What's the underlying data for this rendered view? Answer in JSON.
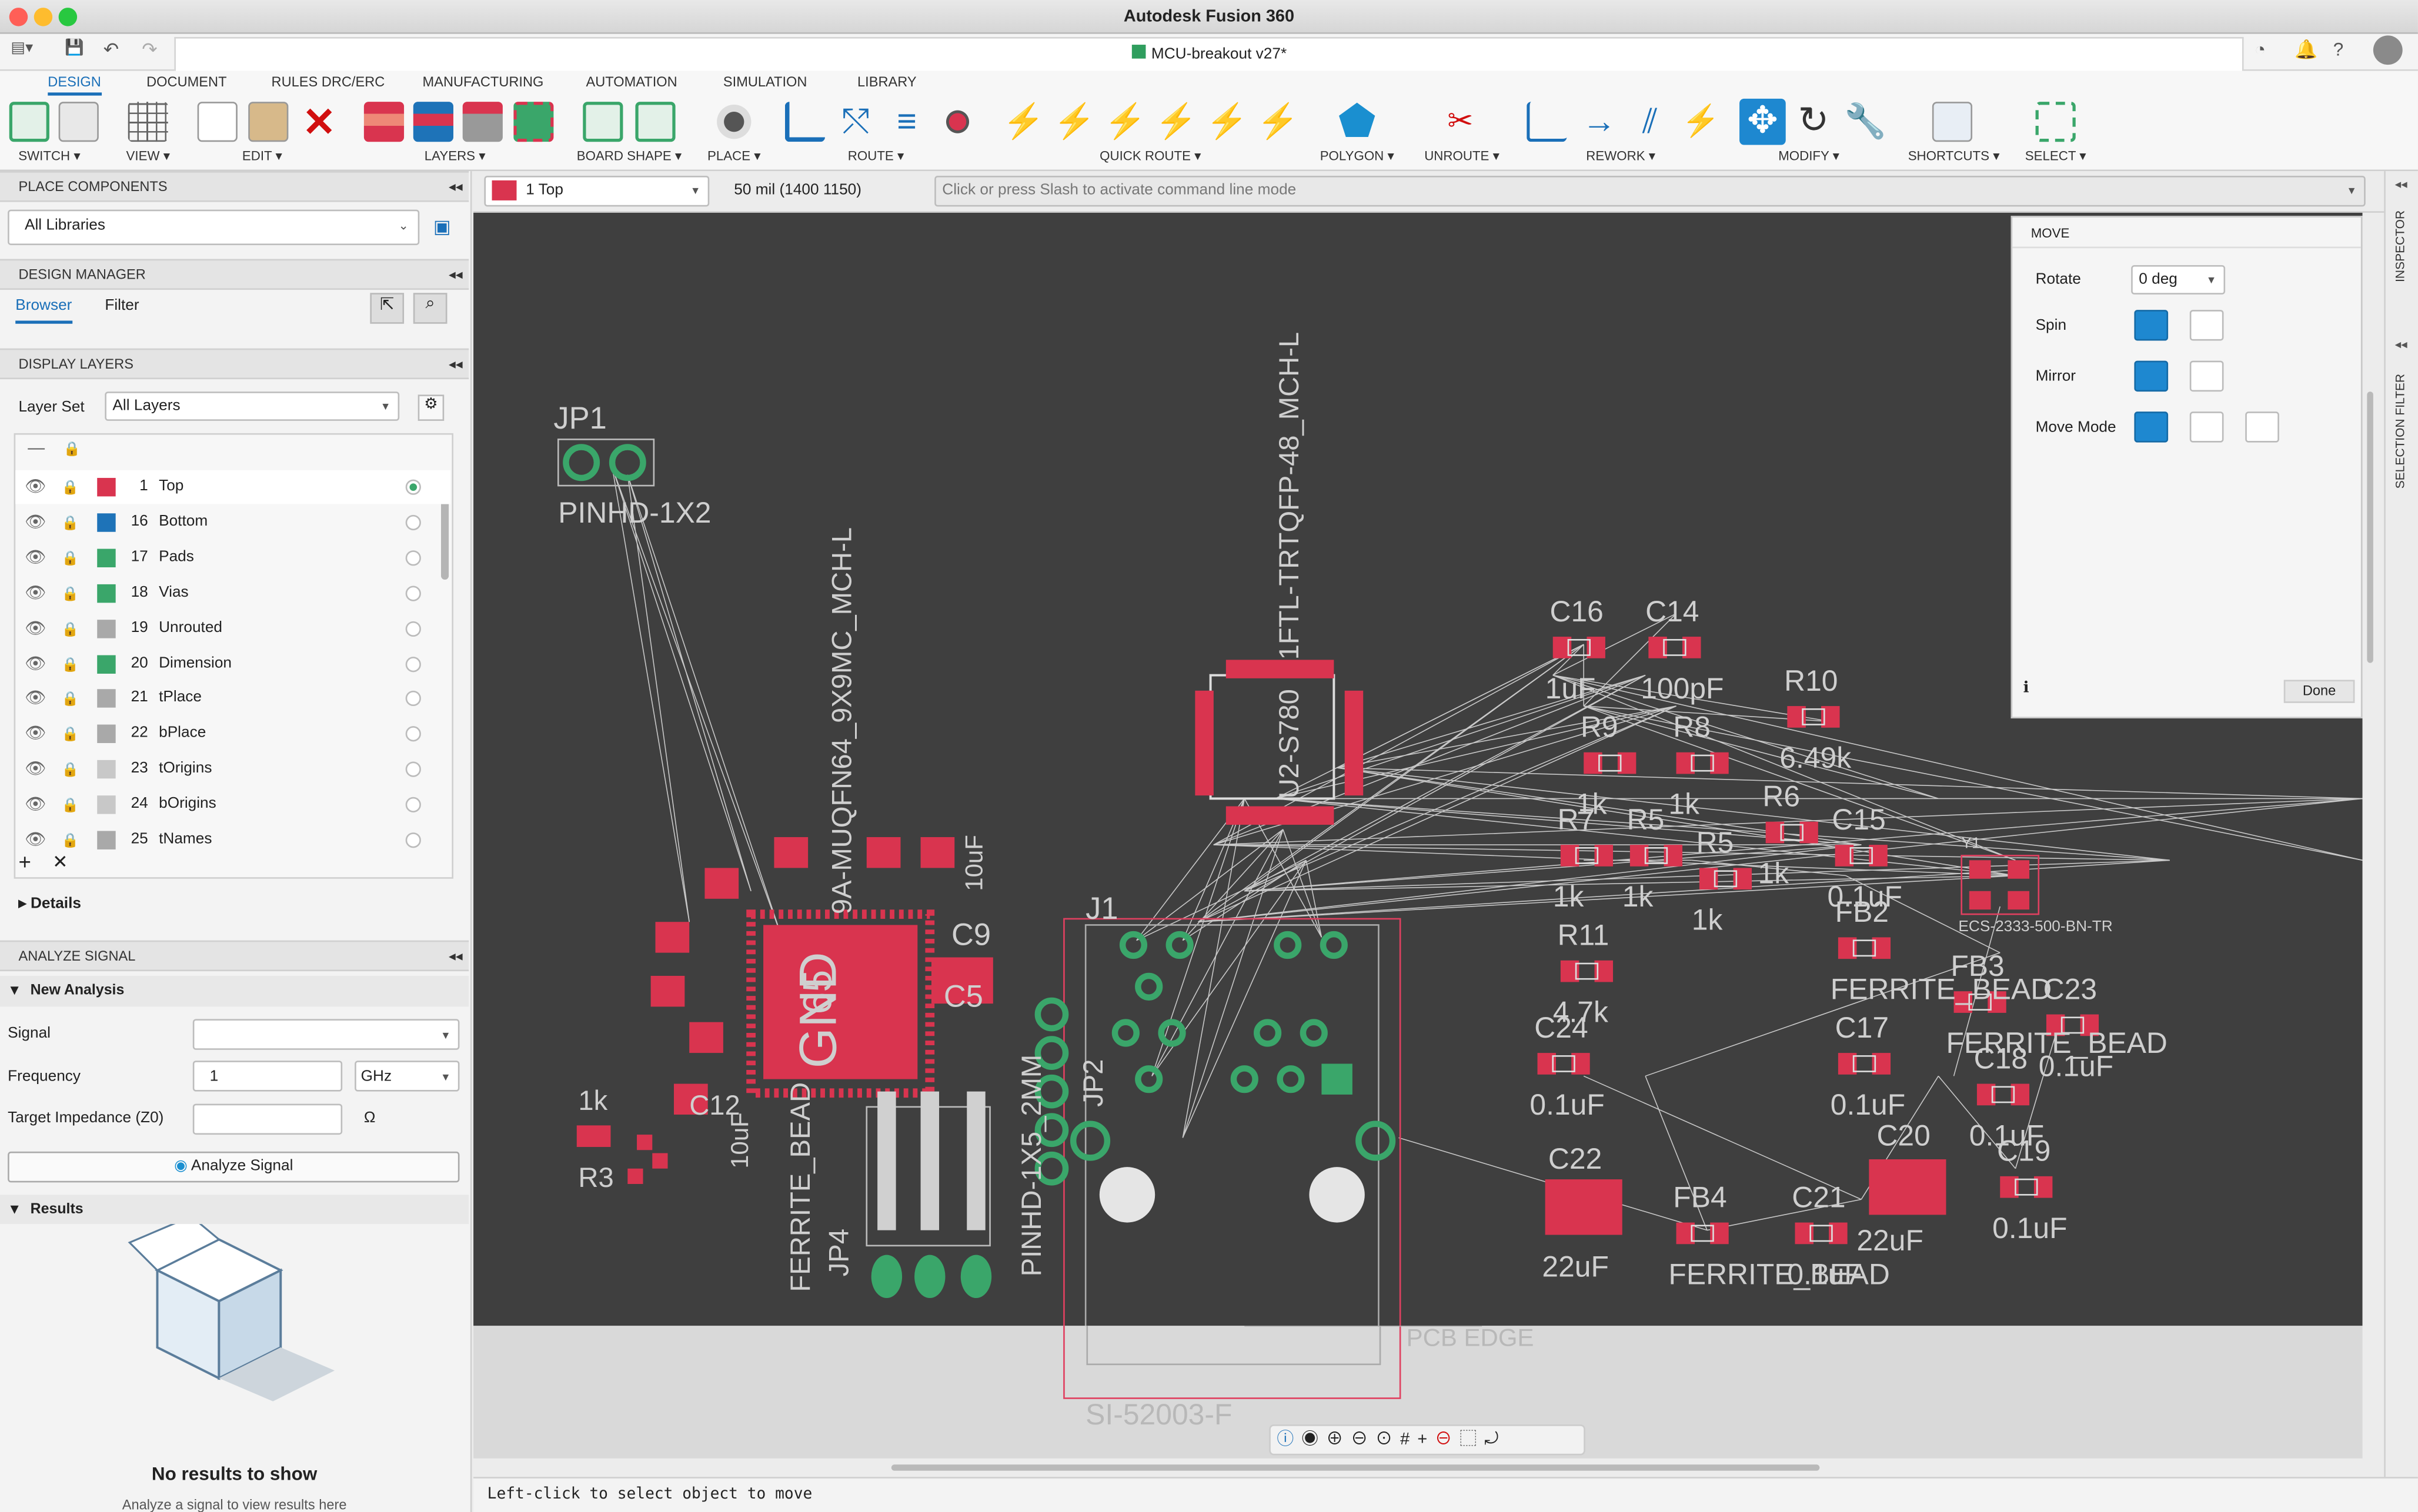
{
  "app_title": "Autodesk Fusion 360",
  "document_tab": "MCU-breakout v27*",
  "ribbon": {
    "tabs": [
      "DESIGN",
      "DOCUMENT",
      "RULES DRC/ERC",
      "MANUFACTURING",
      "AUTOMATION",
      "SIMULATION",
      "LIBRARY"
    ],
    "groups": [
      "SWITCH",
      "VIEW",
      "EDIT",
      "LAYERS",
      "BOARD SHAPE",
      "PLACE",
      "ROUTE",
      "QUICK ROUTE",
      "POLYGON",
      "UNROUTE",
      "REWORK",
      "MODIFY",
      "SHORTCUTS",
      "SELECT"
    ]
  },
  "left_panel": {
    "place_components": "PLACE COMPONENTS",
    "library_select": "All Libraries",
    "design_manager": "DESIGN MANAGER",
    "browser_tab": "Browser",
    "filter_tab": "Filter",
    "display_layers": "DISPLAY LAYERS",
    "layer_set_label": "Layer Set",
    "layer_set_value": "All Layers",
    "layers": [
      {
        "num": "1",
        "name": "Top",
        "color": "#d9344f"
      },
      {
        "num": "16",
        "name": "Bottom",
        "color": "#1e73b8"
      },
      {
        "num": "17",
        "name": "Pads",
        "color": "#3aa66a"
      },
      {
        "num": "18",
        "name": "Vias",
        "color": "#3aa66a"
      },
      {
        "num": "19",
        "name": "Unrouted",
        "color": "#a9a9a9"
      },
      {
        "num": "20",
        "name": "Dimension",
        "color": "#3aa66a"
      },
      {
        "num": "21",
        "name": "tPlace",
        "color": "#a9a9a9"
      },
      {
        "num": "22",
        "name": "bPlace",
        "color": "#a9a9a9"
      },
      {
        "num": "23",
        "name": "tOrigins",
        "color": "#c8c8c8"
      },
      {
        "num": "24",
        "name": "bOrigins",
        "color": "#c8c8c8"
      },
      {
        "num": "25",
        "name": "tNames",
        "color": "#a9a9a9"
      }
    ],
    "details": "Details",
    "analyze_signal": "ANALYZE SIGNAL",
    "new_analysis": "New Analysis",
    "signal_label": "Signal",
    "frequency_label": "Frequency",
    "frequency_value": "1",
    "frequency_unit": "GHz",
    "impedance_label": "Target Impedance (Z0)",
    "impedance_unit": "Ω",
    "analyze_button": "Analyze Signal",
    "results": "Results",
    "no_results": "No results to show",
    "no_results_hint": "Analyze a signal to view results here"
  },
  "command_bar": {
    "layer_select": "1 Top",
    "grid_info": "50 mil (1400 1150)",
    "command_placeholder": "Click or press Slash to activate command line mode"
  },
  "move_panel": {
    "title": "MOVE",
    "rotate_label": "Rotate",
    "rotate_value": "0 deg",
    "spin_label": "Spin",
    "mirror_label": "Mirror",
    "move_mode_label": "Move Mode",
    "done": "Done"
  },
  "right_strip": {
    "inspector": "INSPECTOR",
    "selection_filter": "SELECTION FILTER"
  },
  "status": "Left-click to select object to move",
  "board_labels": {
    "jp1": "JP1",
    "jp1_pkg": "PINHD-1X2",
    "mcu_pkg": "9A-MUQFN64_9X9MC_MCH-L",
    "u2_pkg": "1FTL-TRTQFP-48_MCH-L",
    "u2_name": "U2-S780",
    "gnd": "GND",
    "gnd_num": "65",
    "j1": "J1",
    "j1_pkg": "SI-52003-F",
    "pcb_edge": "PCB EDGE",
    "jp2": "JP2",
    "jp4": "JP4",
    "pinhd_pkg": "PINHD-1X5_2MM",
    "ferrite": "FERRITE_BEAD",
    "xtal": "ECS-2333-500-BN-TR",
    "y1": "Y1",
    "c16": "C16",
    "c14": "C14",
    "r10": "R10",
    "r9": "R9",
    "r8": "R8",
    "r7": "R7",
    "r6": "R6",
    "r5": "R5",
    "c15": "C15",
    "r11": "R11",
    "fb2": "FB2",
    "fb3": "FB3",
    "c23": "C23",
    "c17": "C17",
    "c18": "C18",
    "c24": "C24",
    "c22": "C22",
    "fb4": "FB4",
    "c21": "C21",
    "c20": "C20",
    "c19": "C19",
    "c9": "C9",
    "c5": "C5",
    "c12": "C12",
    "r3": "R3",
    "v1uf": "1uF",
    "v100pf": "100pF",
    "v649k": "6.49k",
    "v1k": "1k",
    "v47k": "4.7k",
    "v01uf": "0.1uF",
    "v22uf": "22uF",
    "v10uf": "10uF"
  }
}
